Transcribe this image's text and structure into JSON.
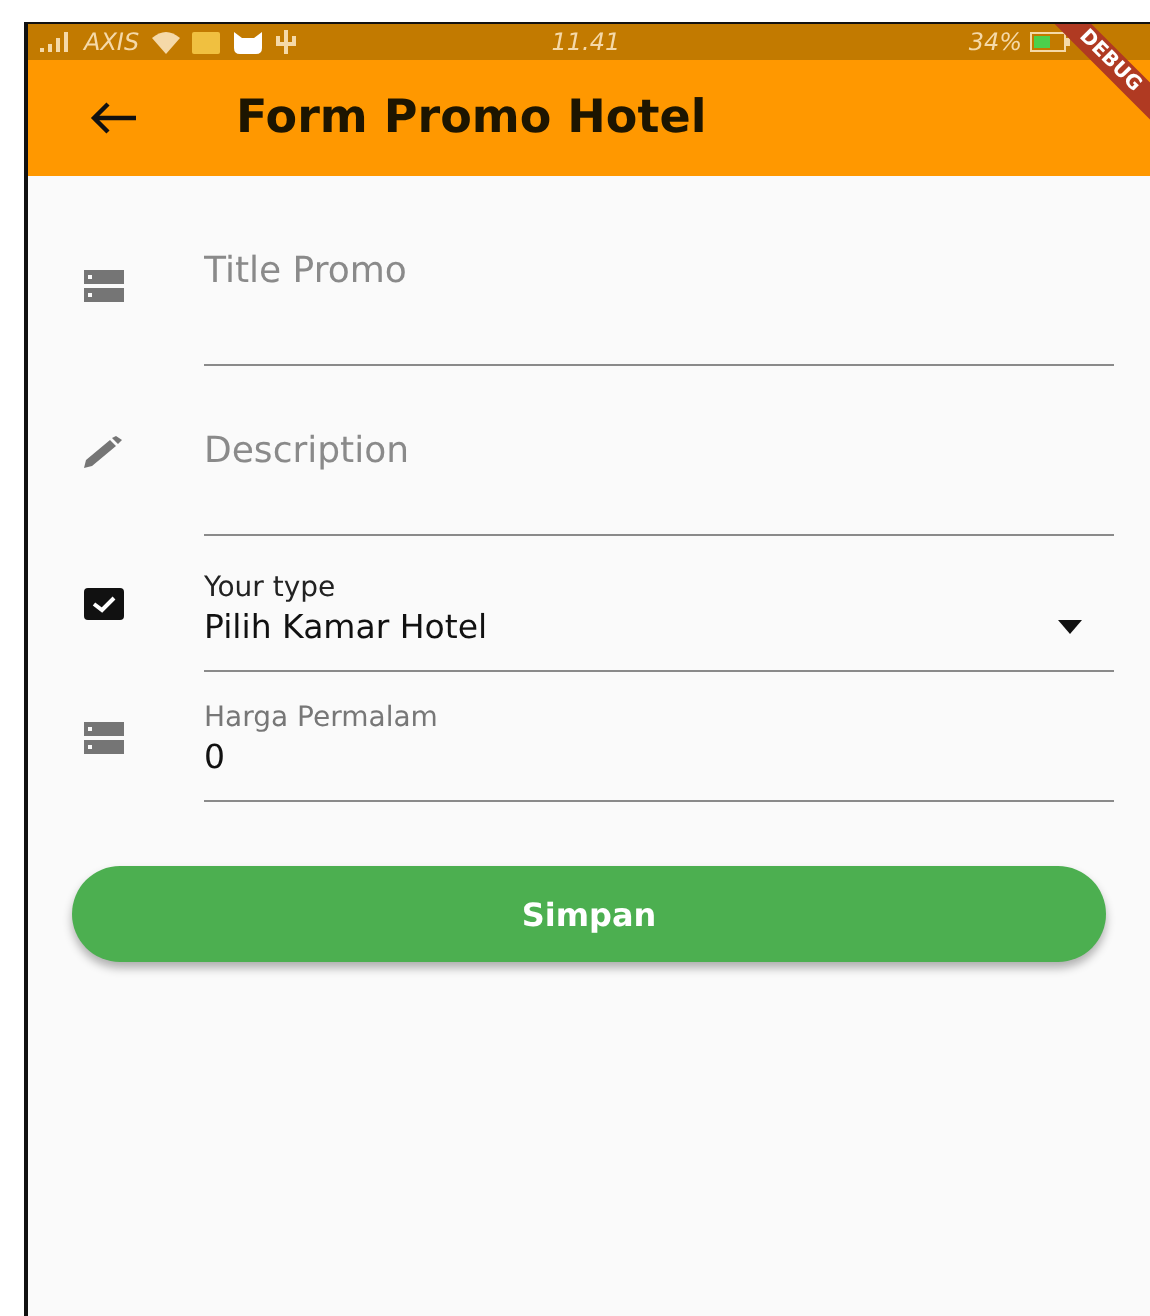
{
  "status_bar": {
    "carrier": "AXIS",
    "time": "11.41",
    "battery": "34%"
  },
  "debug_banner": "DEBUG",
  "app_bar": {
    "title": "Form Promo Hotel"
  },
  "fields": [
    {
      "kind": "text",
      "placeholder": "Title Promo"
    },
    {
      "kind": "multiline",
      "placeholder": "Description"
    },
    {
      "kind": "dropdown",
      "label": "Your type",
      "value": "Pilih Kamar Hotel"
    },
    {
      "kind": "number",
      "label": "Harga Permalam",
      "value": "0"
    }
  ],
  "buttons": [
    "Simpan"
  ]
}
